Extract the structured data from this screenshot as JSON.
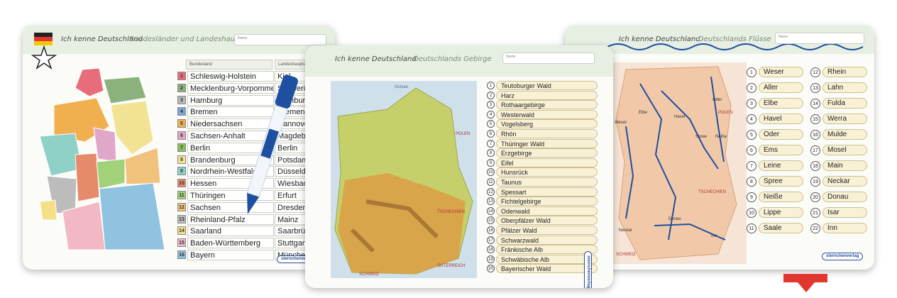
{
  "card_states": {
    "title": "Ich kenne Deutschland",
    "subtitle": "Bundesländer und Landeshauptstädte",
    "name_label": "Name",
    "col_state": "Bundesland",
    "col_capital": "Landeshauptstadt",
    "logo": "sternchenverlag",
    "rows": [
      {
        "n": "1",
        "state": "Schleswig-Holstein",
        "capital": "Kiel",
        "color": "#e86d7a"
      },
      {
        "n": "2",
        "state": "Mecklenburg-Vorpommern",
        "capital": "Schwerin",
        "color": "#8bb27c"
      },
      {
        "n": "3",
        "state": "Hamburg",
        "capital": "Hamburg",
        "color": "#b9b9b9"
      },
      {
        "n": "4",
        "state": "Bremen",
        "capital": "Bremen",
        "color": "#7fa7d9"
      },
      {
        "n": "5",
        "state": "Niedersachsen",
        "capital": "Hannover",
        "color": "#f0b04f"
      },
      {
        "n": "6",
        "state": "Sachsen-Anhalt",
        "capital": "Magdeburg",
        "color": "#e0a7c9"
      },
      {
        "n": "7",
        "state": "Berlin",
        "capital": "Berlin",
        "color": "#8bbf5a"
      },
      {
        "n": "8",
        "state": "Brandenburg",
        "capital": "Potsdam",
        "color": "#f2e394"
      },
      {
        "n": "9",
        "state": "Nordrhein-Westfalen",
        "capital": "Düsseldorf",
        "color": "#8fd1c6"
      },
      {
        "n": "10",
        "state": "Hessen",
        "capital": "Wiesbaden",
        "color": "#e68a6c"
      },
      {
        "n": "11",
        "state": "Thüringen",
        "capital": "Erfurt",
        "color": "#a3d17a"
      },
      {
        "n": "12",
        "state": "Sachsen",
        "capital": "Dresden",
        "color": "#f1c27c"
      },
      {
        "n": "13",
        "state": "Rheinland-Pfalz",
        "capital": "Mainz",
        "color": "#bcbcbc"
      },
      {
        "n": "14",
        "state": "Saarland",
        "capital": "Saarbrücken",
        "color": "#f5e08a"
      },
      {
        "n": "15",
        "state": "Baden-Württemberg",
        "capital": "Stuttgart",
        "color": "#f3b8c6"
      },
      {
        "n": "16",
        "state": "Bayern",
        "capital": "München",
        "color": "#8fc3e0"
      }
    ]
  },
  "card_mountains": {
    "title": "Ich kenne Deutschland",
    "subtitle": "Deutschlands Gebirge",
    "name_label": "Name",
    "map_labels": {
      "sea": "Ostsee",
      "poland": "POLEN",
      "czech": "TSCHECHIEN",
      "austria": "ÖSTERREICH",
      "swiss": "SCHWEIZ"
    },
    "logo": "sternchenverlag",
    "rows": [
      {
        "n": "1",
        "name": "Teutoburger Wald"
      },
      {
        "n": "2",
        "name": "Harz"
      },
      {
        "n": "3",
        "name": "Rothaargebirge"
      },
      {
        "n": "4",
        "name": "Westerwald"
      },
      {
        "n": "5",
        "name": "Vogelsberg"
      },
      {
        "n": "6",
        "name": "Rhön"
      },
      {
        "n": "7",
        "name": "Thüringer Wald"
      },
      {
        "n": "8",
        "name": "Erzgebirge"
      },
      {
        "n": "9",
        "name": "Eifel"
      },
      {
        "n": "10",
        "name": "Hunsrück"
      },
      {
        "n": "11",
        "name": "Taunus"
      },
      {
        "n": "12",
        "name": "Spessart"
      },
      {
        "n": "13",
        "name": "Fichtelgebirge"
      },
      {
        "n": "14",
        "name": "Odenwald"
      },
      {
        "n": "15",
        "name": "Oberpfälzer Wald"
      },
      {
        "n": "16",
        "name": "Pfälzer Wald"
      },
      {
        "n": "17",
        "name": "Schwarzwald"
      },
      {
        "n": "18",
        "name": "Fränkische Alb"
      },
      {
        "n": "19",
        "name": "Schwäbische Alb"
      },
      {
        "n": "20",
        "name": "Bayerischer Wald"
      }
    ]
  },
  "card_rivers": {
    "title": "Ich kenne Deutschland",
    "subtitle": "Deutschlands Flüsse",
    "name_label": "Name",
    "map_labels": {
      "poland": "POLEN",
      "czech": "TSCHECHIEN",
      "swiss": "SCHWEIZ",
      "elbe": "Elbe",
      "oder": "Oder",
      "weser": "Weser",
      "havel": "Havel",
      "spree": "Spree",
      "neisse": "Neiße",
      "donau": "Donau",
      "inn": "Inn",
      "neckar": "Neckar"
    },
    "logo": "sternchenverlag",
    "rows": [
      {
        "n": "1",
        "name": "Weser"
      },
      {
        "n": "2",
        "name": "Aller"
      },
      {
        "n": "3",
        "name": "Elbe"
      },
      {
        "n": "4",
        "name": "Havel"
      },
      {
        "n": "5",
        "name": "Oder"
      },
      {
        "n": "6",
        "name": "Ems"
      },
      {
        "n": "7",
        "name": "Leine"
      },
      {
        "n": "8",
        "name": "Spree"
      },
      {
        "n": "9",
        "name": "Neiße"
      },
      {
        "n": "10",
        "name": "Lippe"
      },
      {
        "n": "11",
        "name": "Saale"
      },
      {
        "n": "12",
        "name": "Rhein"
      },
      {
        "n": "13",
        "name": "Lahn"
      },
      {
        "n": "14",
        "name": "Fulda"
      },
      {
        "n": "15",
        "name": "Werra"
      },
      {
        "n": "16",
        "name": "Mulde"
      },
      {
        "n": "17",
        "name": "Mosel"
      },
      {
        "n": "18",
        "name": "Main"
      },
      {
        "n": "19",
        "name": "Neckar"
      },
      {
        "n": "20",
        "name": "Donau"
      },
      {
        "n": "21",
        "name": "Isar"
      },
      {
        "n": "22",
        "name": "Inn"
      }
    ]
  },
  "colors": {
    "accent_red": "#e2372f",
    "header_green": "#e6efe2",
    "pill_cream": "#f8f1d6",
    "marker_blue": "#1f4fa0"
  }
}
